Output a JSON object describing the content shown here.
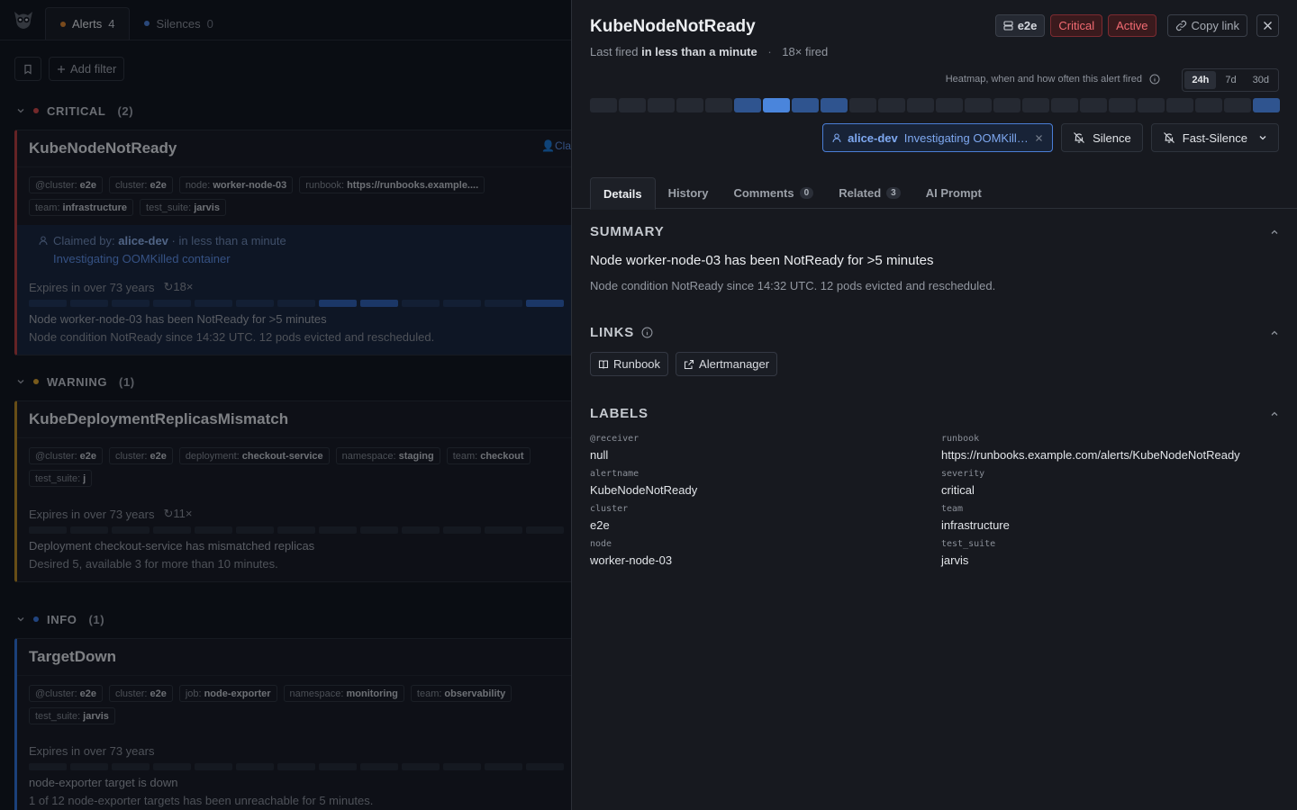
{
  "topbar": {
    "tabs": [
      {
        "label": "Alerts",
        "count": "4",
        "color": "#d9822b"
      },
      {
        "label": "Silences",
        "count": "0",
        "color": "#4a7ed6"
      }
    ]
  },
  "filterbar": {
    "add_filter": "Add filter"
  },
  "groups": [
    {
      "name": "CRITICAL",
      "count": "(2)",
      "color": "#d04545",
      "card": {
        "title": "KubeNodeNotReady",
        "claim_tag": "Cla",
        "chips": [
          {
            "k": "@cluster:",
            "v": "e2e"
          },
          {
            "k": "cluster:",
            "v": "e2e"
          },
          {
            "k": "node:",
            "v": "worker-node-03"
          },
          {
            "k": "runbook:",
            "v": "https://runbooks.example...."
          },
          {
            "k": "team:",
            "v": "infrastructure"
          },
          {
            "k": "test_suite:",
            "v": "jarvis"
          }
        ],
        "claim": {
          "prefix": "Claimed by:",
          "user": "alice-dev",
          "when": "· in less than a minute",
          "note": "Investigating OOMKilled container"
        },
        "expires": "Expires in over 73 years",
        "fired": "18×",
        "desc1": "Node worker-node-03 has been NotReady for >5 minutes",
        "desc2": "Node condition NotReady since 14:32 UTC. 12 pods evicted and rescheduled."
      }
    },
    {
      "name": "WARNING",
      "count": "(1)",
      "color": "#d9a02b",
      "card": {
        "title": "KubeDeploymentReplicasMismatch",
        "chips": [
          {
            "k": "@cluster:",
            "v": "e2e"
          },
          {
            "k": "cluster:",
            "v": "e2e"
          },
          {
            "k": "deployment:",
            "v": "checkout-service"
          },
          {
            "k": "namespace:",
            "v": "staging"
          },
          {
            "k": "team:",
            "v": "checkout"
          },
          {
            "k": "test_suite:",
            "v": "j"
          }
        ],
        "expires": "Expires in over 73 years",
        "fired": "11×",
        "desc1": "Deployment checkout-service has mismatched replicas",
        "desc2": "Desired 5, available 3 for more than 10 minutes."
      }
    },
    {
      "name": "INFO",
      "count": "(1)",
      "color": "#3a78e0",
      "card": {
        "title": "TargetDown",
        "chips": [
          {
            "k": "@cluster:",
            "v": "e2e"
          },
          {
            "k": "cluster:",
            "v": "e2e"
          },
          {
            "k": "job:",
            "v": "node-exporter"
          },
          {
            "k": "namespace:",
            "v": "monitoring"
          },
          {
            "k": "team:",
            "v": "observability"
          },
          {
            "k": "test_suite:",
            "v": "jarvis"
          }
        ],
        "expires": "Expires in over 73 years",
        "desc1": "node-exporter target is down",
        "desc2": "1 of 12 node-exporter targets has been unreachable for 5 minutes."
      }
    }
  ],
  "panel": {
    "title": "KubeNodeNotReady",
    "last_fired_prefix": "Last fired",
    "last_fired_value": "in less than a minute",
    "fired_count": "18× fired",
    "badges": {
      "env": "e2e",
      "severity": "Critical",
      "state": "Active",
      "copy": "Copy link"
    },
    "heatmap_caption": "Heatmap, when and how often this alert fired",
    "ranges": [
      "24h",
      "7d",
      "30d"
    ],
    "selected_range": "24h",
    "heatmap_levels": [
      0,
      0,
      0,
      0,
      0,
      1,
      2,
      1,
      1,
      0,
      0,
      0,
      0,
      0,
      0,
      0,
      0,
      0,
      0,
      0,
      0,
      0,
      0,
      1
    ],
    "heat_colors": [
      "#252932",
      "#2f548f",
      "#4a85dc"
    ],
    "claim": {
      "user": "alice-dev",
      "note": "Investigating OOMKilled container"
    },
    "silence": "Silence",
    "fast_silence": "Fast-Silence",
    "tabs": [
      {
        "label": "Details"
      },
      {
        "label": "History"
      },
      {
        "label": "Comments",
        "count": "0"
      },
      {
        "label": "Related",
        "count": "3"
      },
      {
        "label": "AI Prompt"
      }
    ],
    "summary_h": "SUMMARY",
    "summary_main": "Node worker-node-03 has been NotReady for >5 minutes",
    "summary_sub": "Node condition NotReady since 14:32 UTC. 12 pods evicted and rescheduled.",
    "links_h": "LINKS",
    "links": [
      "Runbook",
      "Alertmanager"
    ],
    "labels_h": "LABELS",
    "labels": [
      {
        "k": "@receiver",
        "v": "null"
      },
      {
        "k": "runbook",
        "v": "https://runbooks.example.com/alerts/KubeNodeNotReady"
      },
      {
        "k": "alertname",
        "v": "KubeNodeNotReady"
      },
      {
        "k": "severity",
        "v": "critical"
      },
      {
        "k": "cluster",
        "v": "e2e"
      },
      {
        "k": "team",
        "v": "infrastructure"
      },
      {
        "k": "node",
        "v": "worker-node-03"
      },
      {
        "k": "test_suite",
        "v": "jarvis"
      }
    ]
  }
}
